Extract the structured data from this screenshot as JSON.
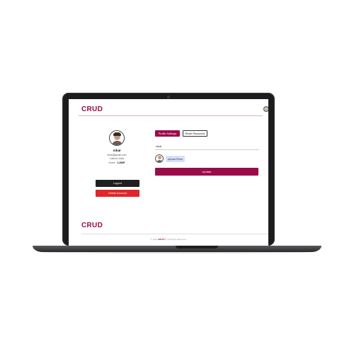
{
  "header": {
    "logo": "CRUD"
  },
  "profile": {
    "name": "nihal",
    "email": "nihal@gmail.com",
    "location": "Calicut, India",
    "score_label": "Score",
    "score_value": "3,250P"
  },
  "actions": {
    "logout_label": "Logout",
    "delete_label": "Delete Account"
  },
  "tabs": [
    {
      "label": "Profile Settings",
      "active": true
    },
    {
      "label": "Reset Password",
      "active": false
    }
  ],
  "form": {
    "name_value": "nihal",
    "upload_label": "Upload Photo",
    "update_label": "Update"
  },
  "footer": {
    "logo": "CRUD",
    "copyright_prefix": "© 2024",
    "copyright_brand": "CRUD™",
    "copyright_suffix": ". All Rights Reserved."
  },
  "colors": {
    "brand": "#9b0b4a",
    "danger": "#e0262b",
    "dark_button": "#1f1f1f",
    "upload_button": "#d6e0fb",
    "laptop_frame": "#1c1c1e"
  },
  "icons": {
    "header_avatar": "user-avatar-icon",
    "profile_avatar": "user-avatar-icon",
    "photo_preview": "user-avatar-icon"
  }
}
